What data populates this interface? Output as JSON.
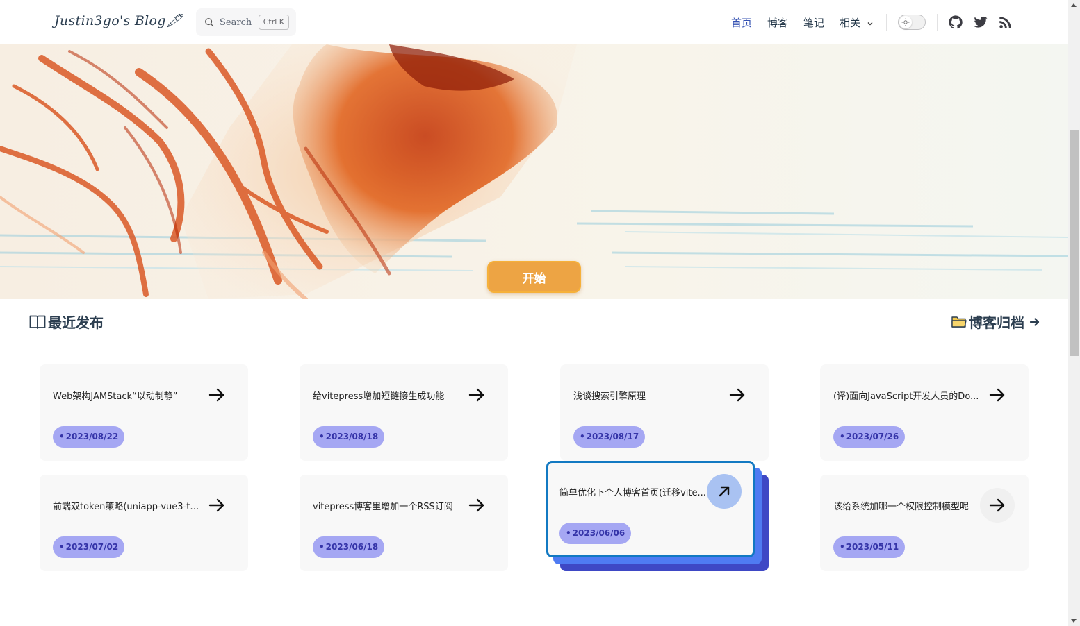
{
  "nav": {
    "logo": "Justin3go's Blog🖋",
    "search_placeholder": "Search",
    "search_shortcut": "Ctrl K",
    "items": [
      {
        "label": "首页",
        "active": true
      },
      {
        "label": "博客",
        "active": false
      },
      {
        "label": "笔记",
        "active": false
      },
      {
        "label": "相关",
        "active": false,
        "dropdown": true
      }
    ],
    "social_icons": [
      "github-icon",
      "twitter-icon",
      "rss-icon"
    ]
  },
  "hero": {
    "button_label": "开始"
  },
  "recent": {
    "title": "最近发布",
    "archive_link": "博客归档",
    "posts": [
      {
        "title": "Web架构JAMStack“以动制静”",
        "date": "2023/08/22"
      },
      {
        "title": "给vitepress增加短链接生成功能",
        "date": "2023/08/18"
      },
      {
        "title": "浅谈搜索引擎原理",
        "date": "2023/08/17"
      },
      {
        "title": "(译)面向JavaScript开发人员的Do...",
        "date": "2023/07/26"
      },
      {
        "title": "前端双token策略(uniapp-vue3-ts...",
        "date": "2023/07/02"
      },
      {
        "title": "vitepress博客里增加一个RSS订阅",
        "date": "2023/06/18"
      },
      {
        "title": "简单优化下个人博客首页(迁移vite...",
        "date": "2023/06/06",
        "hovered": true
      },
      {
        "title": "该给系统加哪一个权限控制模型呢",
        "date": "2023/05/11"
      }
    ]
  },
  "colors": {
    "accent": "#3451b2",
    "button": "#eda444",
    "date_badge": "#a5a7f3",
    "featured_border": "#1279c2"
  }
}
